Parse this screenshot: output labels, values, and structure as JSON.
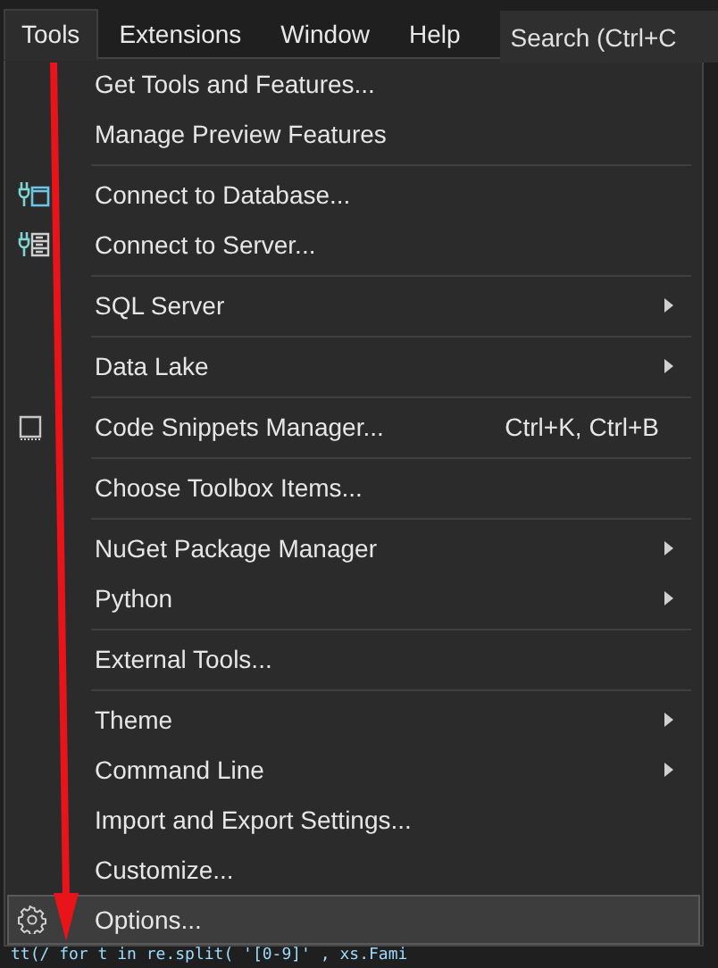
{
  "menubar": {
    "items": [
      {
        "label": "Tools",
        "selected": true
      },
      {
        "label": "Extensions",
        "selected": false
      },
      {
        "label": "Window",
        "selected": false
      },
      {
        "label": "Help",
        "selected": false
      }
    ],
    "search": {
      "placeholder": "Search (Ctrl+C"
    }
  },
  "menu": {
    "groups": [
      {
        "items": [
          {
            "label": "Get Tools and Features...",
            "submenu": false,
            "selected": false
          },
          {
            "label": "Manage Preview Features",
            "submenu": false,
            "selected": false
          }
        ]
      },
      {
        "items": [
          {
            "label": "Connect to Database...",
            "submenu": false,
            "selected": false
          },
          {
            "label": "Connect to Server...",
            "submenu": false,
            "selected": false
          }
        ]
      },
      {
        "items": [
          {
            "label": "SQL Server",
            "submenu": true,
            "selected": false
          }
        ]
      },
      {
        "items": [
          {
            "label": "Data Lake",
            "submenu": true,
            "selected": false
          }
        ]
      },
      {
        "items": [
          {
            "label": "Code Snippets Manager...",
            "shortcut": "Ctrl+K, Ctrl+B",
            "submenu": false,
            "selected": false
          }
        ]
      },
      {
        "items": [
          {
            "label": "Choose Toolbox Items...",
            "submenu": false,
            "selected": false
          }
        ]
      },
      {
        "items": [
          {
            "label": "NuGet Package Manager",
            "submenu": true,
            "selected": false
          },
          {
            "label": "Python",
            "submenu": true,
            "selected": false
          }
        ]
      },
      {
        "items": [
          {
            "label": "External Tools...",
            "submenu": false,
            "selected": false
          }
        ]
      },
      {
        "items": [
          {
            "label": "Theme",
            "submenu": true,
            "selected": false
          },
          {
            "label": "Command Line",
            "submenu": true,
            "selected": false
          },
          {
            "label": "Import and Export Settings...",
            "submenu": false,
            "selected": false
          },
          {
            "label": "Customize...",
            "submenu": false,
            "selected": false
          },
          {
            "label": "Options...",
            "submenu": false,
            "selected": true
          }
        ]
      }
    ]
  },
  "editor": {
    "code_line": "tt(/ for t in re.split( '[0-9]' , xs.Fami"
  }
}
